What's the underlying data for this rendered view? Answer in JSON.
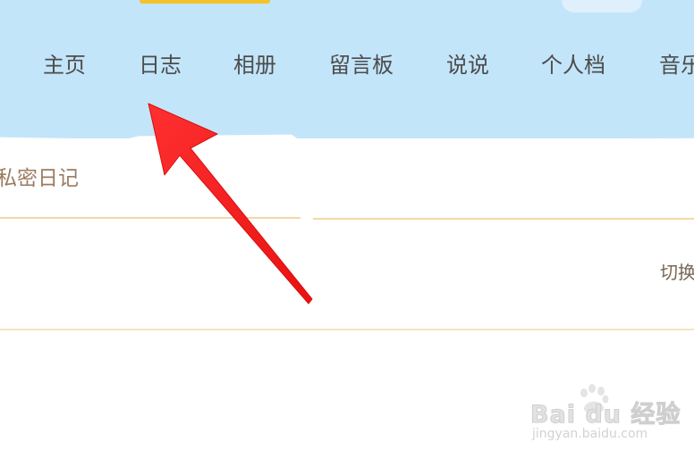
{
  "nav": {
    "items": [
      {
        "label": "主页"
      },
      {
        "label": "日志"
      },
      {
        "label": "相册"
      },
      {
        "label": "留言板"
      },
      {
        "label": "说说"
      },
      {
        "label": "个人档"
      },
      {
        "label": "音乐"
      }
    ]
  },
  "content": {
    "title": "私密日记",
    "switch_label": "切换"
  },
  "annotation": {
    "arrow_color": "#f21b1b",
    "points_to": "日志"
  },
  "watermark": {
    "brand": "Bai du 经验",
    "url": "jingyan.baidu.com"
  },
  "colors": {
    "banner": "#c3e5fa",
    "nav_text": "#4c4c4c",
    "title_text": "#9b7c60",
    "divider": "#f2d8a8"
  }
}
